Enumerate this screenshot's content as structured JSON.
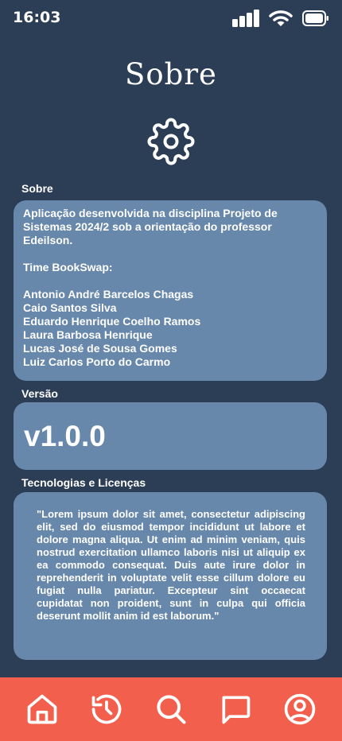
{
  "status": {
    "time": "16:03"
  },
  "header": {
    "title": "Sobre",
    "icon": "gear-icon"
  },
  "about": {
    "label": "Sobre",
    "description": "Aplicação desenvolvida na disciplina Projeto de Sistemas 2024/2 sob a orientação do professor Edeilson.",
    "team_heading": "Time BookSwap:",
    "team": [
      "Antonio André Barcelos Chagas",
      "Caio Santos Silva",
      "Eduardo Henrique Coelho Ramos",
      "Laura Barbosa Henrique",
      "Lucas José de Sousa Gomes",
      "Luiz Carlos Porto do Carmo"
    ]
  },
  "version": {
    "label": "Versão",
    "value": "v1.0.0"
  },
  "tech": {
    "label": "Tecnologias e Licenças",
    "text": "\"Lorem ipsum dolor sit amet, consectetur adipiscing elit, sed do eiusmod tempor incididunt ut labore et dolore magna aliqua. Ut enim ad minim veniam, quis nostrud exercitation ullamco laboris nisi ut aliquip ex ea commodo consequat. Duis aute irure dolor in reprehenderit in voluptate velit esse cillum dolore eu fugiat nulla pariatur. Excepteur sint occaecat cupidatat non proident, sunt in culpa qui officia deserunt mollit anim id est laborum.\""
  },
  "nav": {
    "items": [
      "home-icon",
      "history-icon",
      "search-icon",
      "chat-icon",
      "profile-icon"
    ]
  },
  "colors": {
    "background": "#2c3e56",
    "card": "#6787ab",
    "nav": "#f2604d"
  }
}
